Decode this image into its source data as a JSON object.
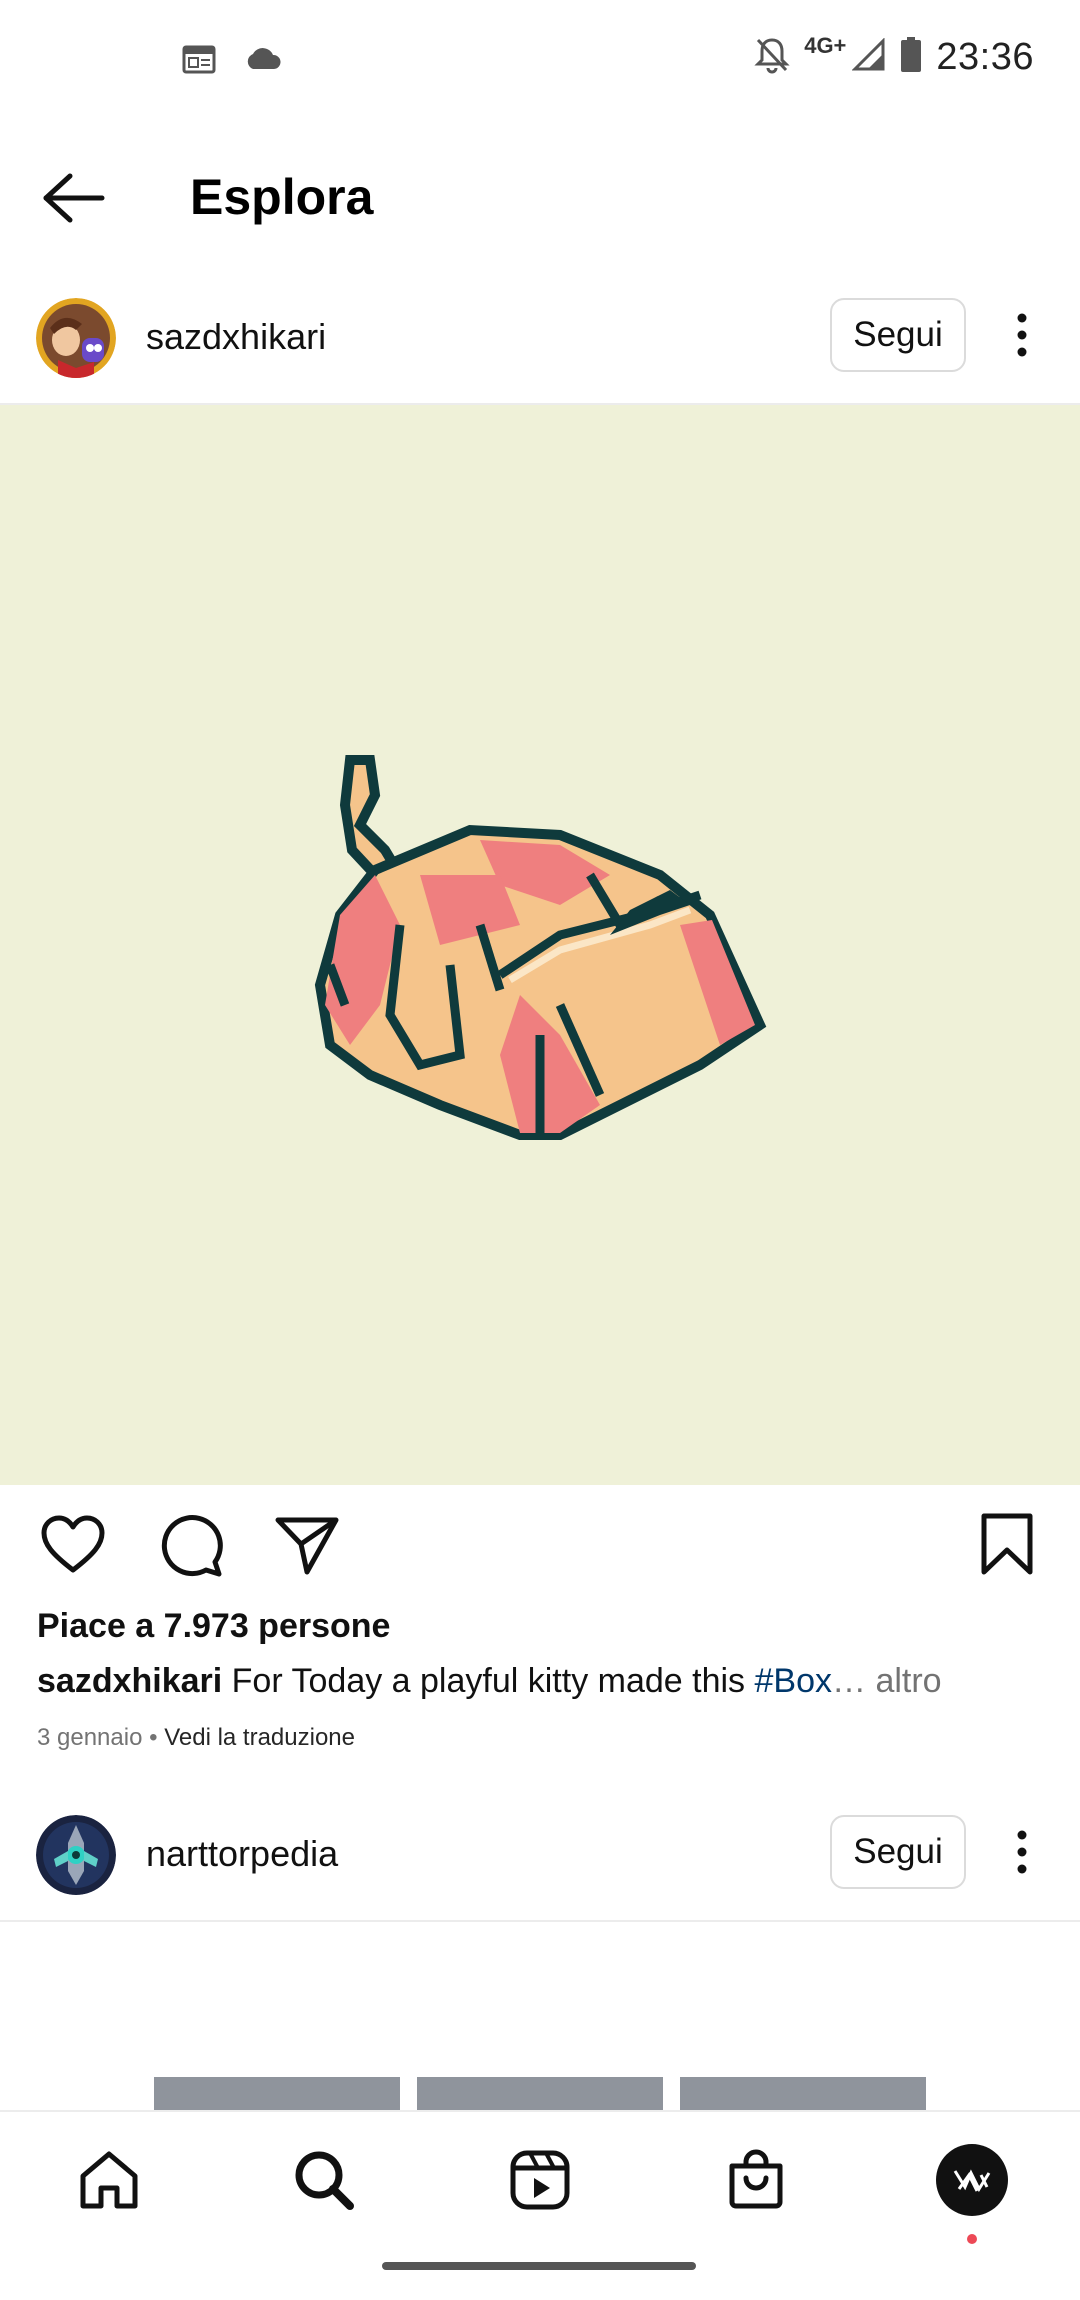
{
  "status_bar": {
    "time": "23:36",
    "network": "4G+",
    "icons": [
      "calendar-icon",
      "cloud-icon",
      "bell-off-icon",
      "signal-icon",
      "battery-icon"
    ]
  },
  "header": {
    "title": "Esplora",
    "back_icon": "arrow-left-icon"
  },
  "posts": [
    {
      "username": "sazdxhikari",
      "follow_label": "Segui",
      "likes_text": "Piace a 7.973 persone",
      "caption_user": "sazdxhikari",
      "caption_text": " For Today a playful kitty made this ",
      "caption_hashtag": "#Box",
      "caption_ellipsis": "…",
      "caption_more": " altro",
      "date": "3 gennaio",
      "separator": " • ",
      "translate_label": "Vedi la traduzione",
      "image_background": "#eff1d8"
    },
    {
      "username": "narttorpedia",
      "follow_label": "Segui"
    }
  ],
  "actions": {
    "icons": [
      "heart-icon",
      "comment-icon",
      "share-icon",
      "bookmark-icon"
    ]
  },
  "bottom_nav": {
    "items": [
      "home-icon",
      "search-icon",
      "reels-icon",
      "shop-icon",
      "profile-avatar"
    ],
    "notification_dot_color": "#ed4956"
  },
  "colors": {
    "hashtag": "#00376b",
    "secondary_text": "#737373",
    "border": "#dbdbdb"
  }
}
